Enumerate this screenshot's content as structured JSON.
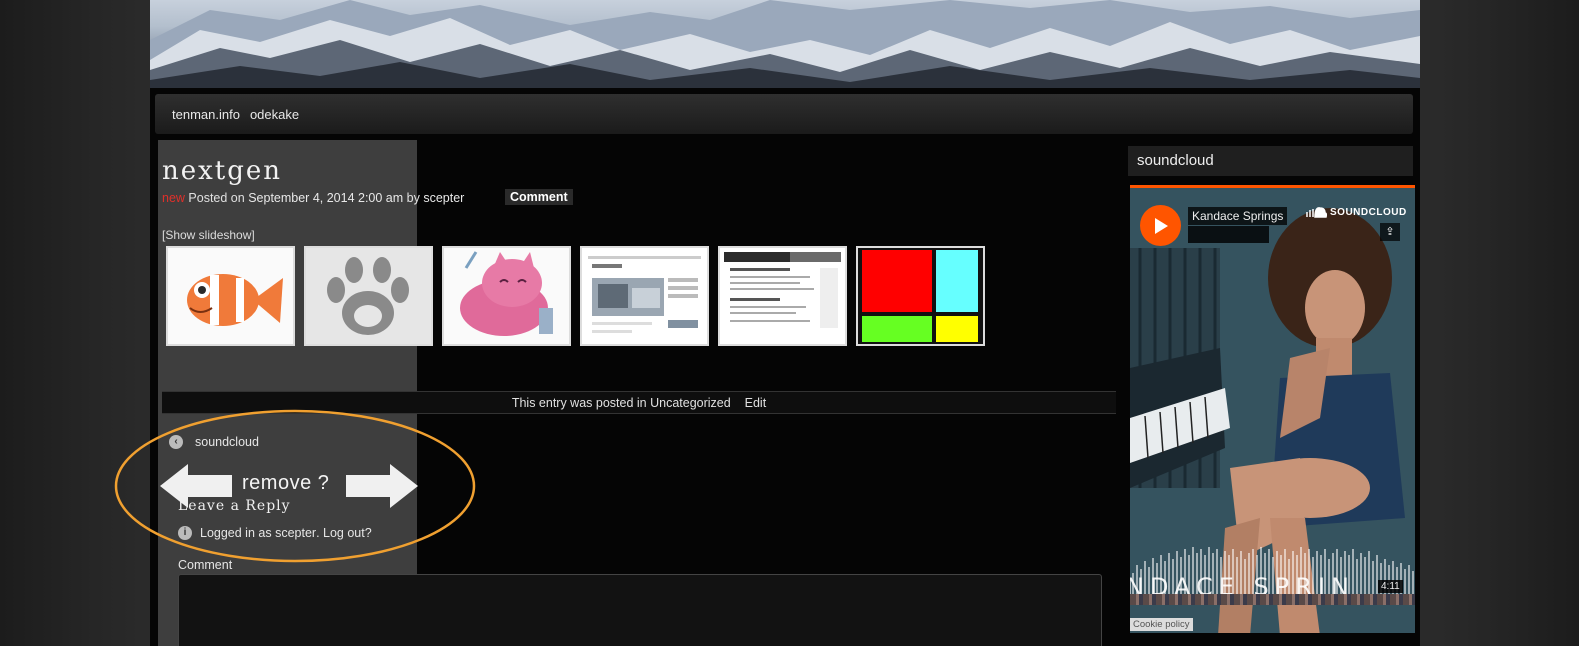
{
  "nav": {
    "items": [
      "tenman.info",
      "odekake"
    ]
  },
  "post": {
    "title": "nextgen",
    "new_label": "new",
    "posted_on": "Posted on",
    "date": "September 4, 2014 2:00 am",
    "by": "by",
    "author": "scepter",
    "comment_button": "Comment",
    "show_slideshow": "[Show slideshow]",
    "thumbnails": [
      "clownfish",
      "paw-print",
      "pink-cat",
      "website-screenshot",
      "document-screenshot",
      "color-blocks"
    ],
    "entry_text": "This entry was posted in",
    "category": "Uncategorized",
    "edit": "Edit"
  },
  "prev_post": {
    "label": "soundcloud"
  },
  "annotation": {
    "text": "remove ?"
  },
  "reply": {
    "heading": "Leave a Reply",
    "logged_in_as": "Logged in as",
    "user": "scepter",
    "logout": "Log out?",
    "comment_label": "Comment"
  },
  "sidebar": {
    "widget_title": "soundcloud",
    "player": {
      "artist": "Kandace Springs",
      "brand": "SOUNDCLOUD",
      "wave_text": "NDACE  SPRIN",
      "duration": "4:11",
      "cookie": "Cookie policy"
    }
  },
  "colors": {
    "accent_orange": "#ff5500",
    "new_red": "#e0302a",
    "annotation_orange": "#f0a030"
  }
}
